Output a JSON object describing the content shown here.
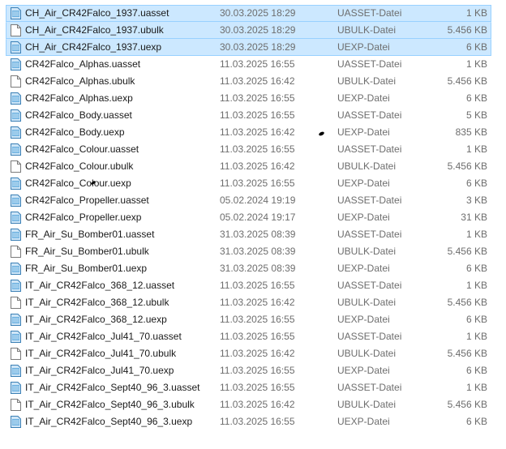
{
  "files": [
    {
      "name": "CH_Air_CR42Falco_1937.uasset",
      "date": "30.03.2025 18:29",
      "type": "UASSET-Datei",
      "size": "1 KB",
      "icon": "asset-file-icon",
      "selected": true
    },
    {
      "name": "CH_Air_CR42Falco_1937.ubulk",
      "date": "30.03.2025 18:29",
      "type": "UBULK-Datei",
      "size": "5.456 KB",
      "icon": "blank-file-icon",
      "selected": true
    },
    {
      "name": "CH_Air_CR42Falco_1937.uexp",
      "date": "30.03.2025 18:29",
      "type": "UEXP-Datei",
      "size": "6 KB",
      "icon": "asset-file-icon",
      "selected": true
    },
    {
      "name": "CR42Falco_Alphas.uasset",
      "date": "11.03.2025 16:55",
      "type": "UASSET-Datei",
      "size": "1 KB",
      "icon": "asset-file-icon",
      "selected": false
    },
    {
      "name": "CR42Falco_Alphas.ubulk",
      "date": "11.03.2025 16:42",
      "type": "UBULK-Datei",
      "size": "5.456 KB",
      "icon": "blank-file-icon",
      "selected": false
    },
    {
      "name": "CR42Falco_Alphas.uexp",
      "date": "11.03.2025 16:55",
      "type": "UEXP-Datei",
      "size": "6 KB",
      "icon": "asset-file-icon",
      "selected": false
    },
    {
      "name": "CR42Falco_Body.uasset",
      "date": "11.03.2025 16:55",
      "type": "UASSET-Datei",
      "size": "5 KB",
      "icon": "asset-file-icon",
      "selected": false
    },
    {
      "name": "CR42Falco_Body.uexp",
      "date": "11.03.2025 16:42",
      "type": "UEXP-Datei",
      "size": "835 KB",
      "icon": "asset-file-icon",
      "selected": false
    },
    {
      "name": "CR42Falco_Colour.uasset",
      "date": "11.03.2025 16:55",
      "type": "UASSET-Datei",
      "size": "1 KB",
      "icon": "asset-file-icon",
      "selected": false
    },
    {
      "name": "CR42Falco_Colour.ubulk",
      "date": "11.03.2025 16:42",
      "type": "UBULK-Datei",
      "size": "5.456 KB",
      "icon": "blank-file-icon",
      "selected": false
    },
    {
      "name": "CR42Falco_Colour.uexp",
      "date": "11.03.2025 16:55",
      "type": "UEXP-Datei",
      "size": "6 KB",
      "icon": "asset-file-icon",
      "selected": false
    },
    {
      "name": "CR42Falco_Propeller.uasset",
      "date": "05.02.2024 19:19",
      "type": "UASSET-Datei",
      "size": "3 KB",
      "icon": "asset-file-icon",
      "selected": false
    },
    {
      "name": "CR42Falco_Propeller.uexp",
      "date": "05.02.2024 19:17",
      "type": "UEXP-Datei",
      "size": "31 KB",
      "icon": "asset-file-icon",
      "selected": false
    },
    {
      "name": "FR_Air_Su_Bomber01.uasset",
      "date": "31.03.2025 08:39",
      "type": "UASSET-Datei",
      "size": "1 KB",
      "icon": "asset-file-icon",
      "selected": false
    },
    {
      "name": "FR_Air_Su_Bomber01.ubulk",
      "date": "31.03.2025 08:39",
      "type": "UBULK-Datei",
      "size": "5.456 KB",
      "icon": "blank-file-icon",
      "selected": false
    },
    {
      "name": "FR_Air_Su_Bomber01.uexp",
      "date": "31.03.2025 08:39",
      "type": "UEXP-Datei",
      "size": "6 KB",
      "icon": "asset-file-icon",
      "selected": false
    },
    {
      "name": "IT_Air_CR42Falco_368_12.uasset",
      "date": "11.03.2025 16:55",
      "type": "UASSET-Datei",
      "size": "1 KB",
      "icon": "asset-file-icon",
      "selected": false
    },
    {
      "name": "IT_Air_CR42Falco_368_12.ubulk",
      "date": "11.03.2025 16:42",
      "type": "UBULK-Datei",
      "size": "5.456 KB",
      "icon": "blank-file-icon",
      "selected": false
    },
    {
      "name": "IT_Air_CR42Falco_368_12.uexp",
      "date": "11.03.2025 16:55",
      "type": "UEXP-Datei",
      "size": "6 KB",
      "icon": "asset-file-icon",
      "selected": false
    },
    {
      "name": "IT_Air_CR42Falco_Jul41_70.uasset",
      "date": "11.03.2025 16:55",
      "type": "UASSET-Datei",
      "size": "1 KB",
      "icon": "asset-file-icon",
      "selected": false
    },
    {
      "name": "IT_Air_CR42Falco_Jul41_70.ubulk",
      "date": "11.03.2025 16:42",
      "type": "UBULK-Datei",
      "size": "5.456 KB",
      "icon": "blank-file-icon",
      "selected": false
    },
    {
      "name": "IT_Air_CR42Falco_Jul41_70.uexp",
      "date": "11.03.2025 16:55",
      "type": "UEXP-Datei",
      "size": "6 KB",
      "icon": "asset-file-icon",
      "selected": false
    },
    {
      "name": "IT_Air_CR42Falco_Sept40_96_3.uasset",
      "date": "11.03.2025 16:55",
      "type": "UASSET-Datei",
      "size": "1 KB",
      "icon": "asset-file-icon",
      "selected": false
    },
    {
      "name": "IT_Air_CR42Falco_Sept40_96_3.ubulk",
      "date": "11.03.2025 16:42",
      "type": "UBULK-Datei",
      "size": "5.456 KB",
      "icon": "blank-file-icon",
      "selected": false
    },
    {
      "name": "IT_Air_CR42Falco_Sept40_96_3.uexp",
      "date": "11.03.2025 16:55",
      "type": "UEXP-Datei",
      "size": "6 KB",
      "icon": "asset-file-icon",
      "selected": false
    }
  ],
  "colors": {
    "selection_fill": "#cce8ff",
    "selection_border": "#99d1ff",
    "detail_text": "#6d6d6d",
    "name_text": "#1a1a1a"
  }
}
